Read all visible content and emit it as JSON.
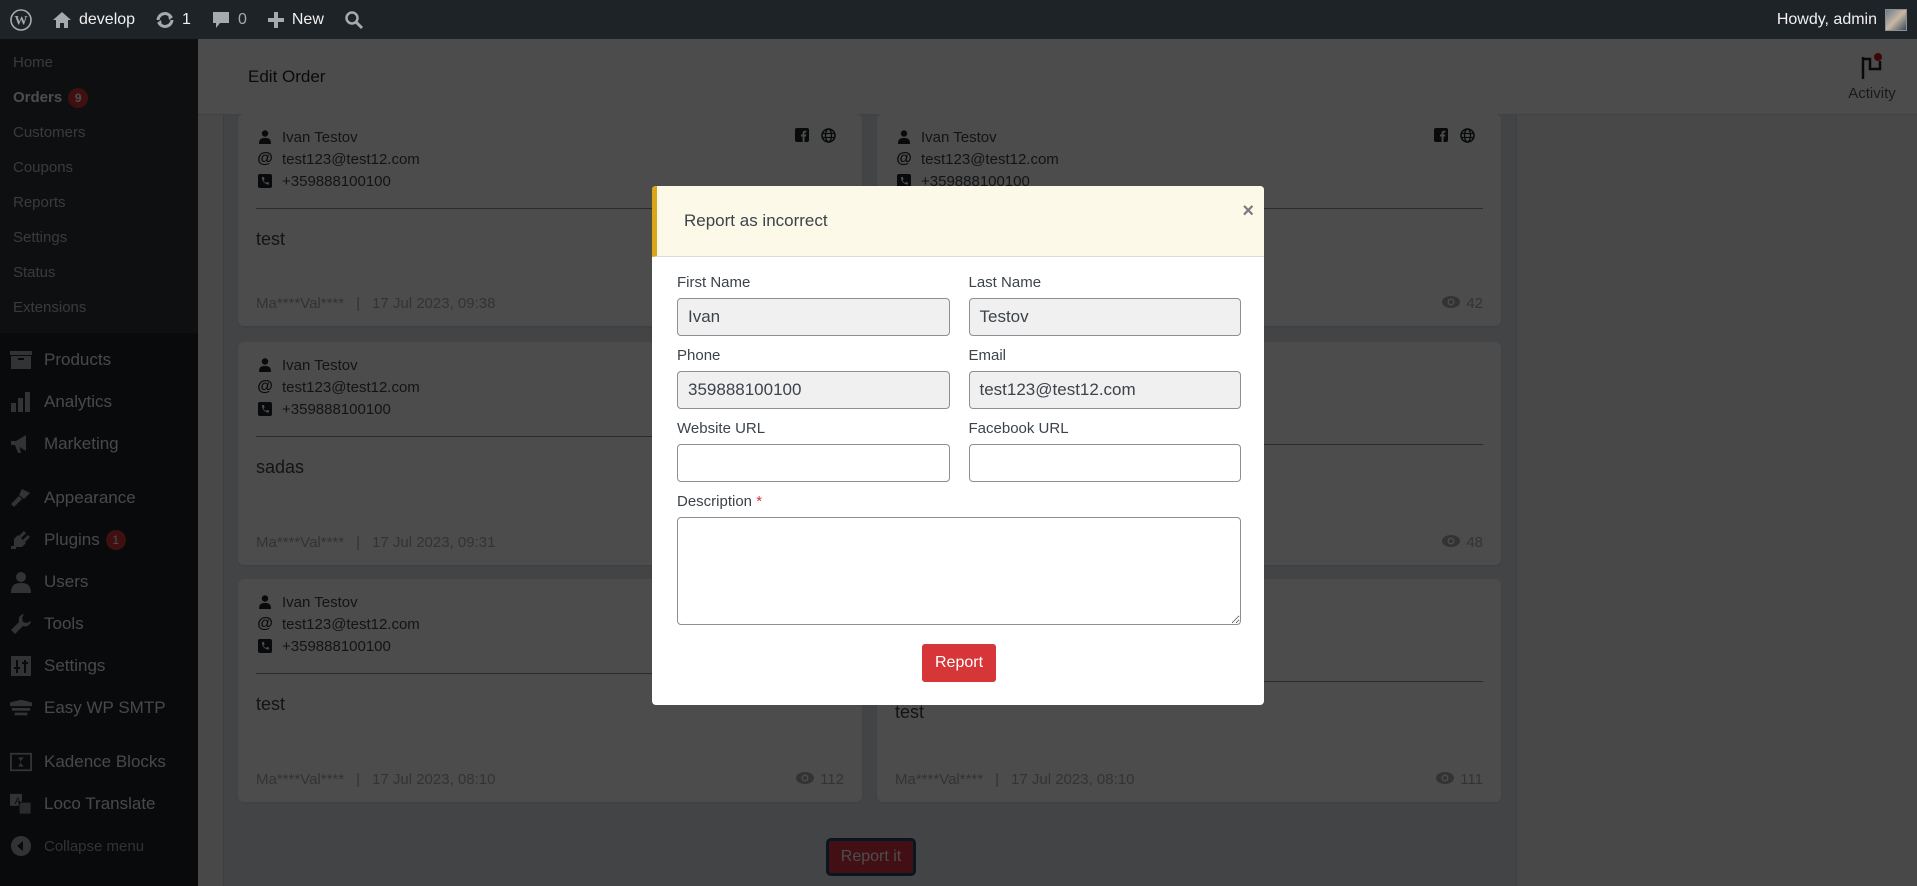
{
  "adminbar": {
    "site_name": "develop",
    "updates_count": "1",
    "comments_count": "0",
    "new_label": "New",
    "greeting": "Howdy, admin"
  },
  "sidebar": {
    "submenu": [
      {
        "label": "Home"
      },
      {
        "label": "Orders",
        "badge": "9",
        "current": true
      },
      {
        "label": "Customers"
      },
      {
        "label": "Coupons"
      },
      {
        "label": "Reports"
      },
      {
        "label": "Settings"
      },
      {
        "label": "Status"
      },
      {
        "label": "Extensions"
      }
    ],
    "menu": [
      {
        "label": "Products",
        "icon": "archive-icon"
      },
      {
        "label": "Analytics",
        "icon": "bar-chart-icon"
      },
      {
        "label": "Marketing",
        "icon": "megaphone-icon"
      },
      {
        "label": "Appearance",
        "icon": "paintbrush-icon"
      },
      {
        "label": "Plugins",
        "icon": "plug-icon",
        "badge": "1"
      },
      {
        "label": "Users",
        "icon": "user-icon"
      },
      {
        "label": "Tools",
        "icon": "wrench-icon"
      },
      {
        "label": "Settings",
        "icon": "settings-sliders-icon"
      },
      {
        "label": "Easy WP SMTP",
        "icon": "mail-stack-icon"
      },
      {
        "label": "Kadence Blocks",
        "icon": "kadence-icon"
      },
      {
        "label": "Loco Translate",
        "icon": "translate-icon"
      }
    ],
    "collapse_label": "Collapse menu"
  },
  "header": {
    "title": "Edit Order",
    "activity_label": "Activity"
  },
  "cards": [
    {
      "name": "Ivan Testov",
      "email": "test123@test12.com",
      "phone": "+359888100100",
      "description": "test",
      "author": "Ma****Val****",
      "date": "17 Jul 2023, 09:38",
      "views": ""
    },
    {
      "name": "Ivan Testov",
      "email": "test123@test12.com",
      "phone": "+359888100100",
      "description": "",
      "author": "",
      "date": "",
      "views": "42"
    },
    {
      "name": "Ivan Testov",
      "email": "test123@test12.com",
      "phone": "+359888100100",
      "description": "sadas",
      "author": "Ma****Val****",
      "date": "17 Jul 2023, 09:31",
      "views": ""
    },
    {
      "name": "",
      "email": "",
      "phone": "",
      "description": "",
      "author": "",
      "date": "",
      "views": "48"
    },
    {
      "name": "Ivan Testov",
      "email": "test123@test12.com",
      "phone": "+359888100100",
      "description": "test",
      "author": "Ma****Val****",
      "date": "17 Jul 2023, 08:10",
      "views": "112"
    },
    {
      "name": "",
      "email": "",
      "phone": "",
      "description": "test",
      "author": "Ma****Val****",
      "date": "17 Jul 2023, 08:10",
      "views": "111"
    }
  ],
  "report_it_label": "Report it",
  "modal": {
    "title": "Report as incorrect",
    "close_glyph": "×",
    "fields": {
      "first_name": {
        "label": "First Name",
        "value": "Ivan"
      },
      "last_name": {
        "label": "Last Name",
        "value": "Testov"
      },
      "phone": {
        "label": "Phone",
        "value": "359888100100"
      },
      "email": {
        "label": "Email",
        "value": "test123@test12.com"
      },
      "website": {
        "label": "Website URL",
        "value": ""
      },
      "facebook": {
        "label": "Facebook URL",
        "value": ""
      },
      "description": {
        "label": "Description",
        "required_mark": "*",
        "value": ""
      }
    },
    "submit_label": "Report"
  },
  "colors": {
    "accent_warning": "#dba617",
    "danger": "#d63638",
    "adminbar_bg": "#1d2327"
  }
}
